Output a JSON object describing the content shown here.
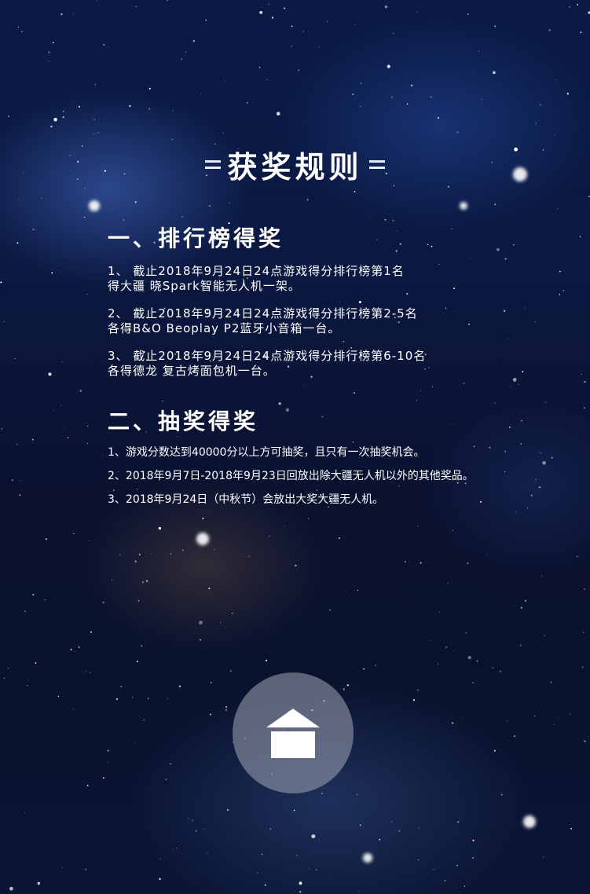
{
  "page": {
    "title": "获奖规则",
    "home_icon": "home-icon"
  },
  "rank_section": {
    "heading": "一、排行榜得奖",
    "rules": [
      {
        "line1": "1、 截止2018年9月24日24点游戏得分排行榜第1名",
        "line2": "得大疆 晓Spark智能无人机一架。"
      },
      {
        "line1": "2、 截止2018年9月24日24点游戏得分排行榜第2-5名",
        "line2": "各得B&O Beoplay P2蓝牙小音箱一台。"
      },
      {
        "line1": "3、 截止2018年9月24日24点游戏得分排行榜第6-10名",
        "line2": "各得德龙 复古烤面包机一台。"
      }
    ]
  },
  "lottery_section": {
    "heading": "二、抽奖得奖",
    "rules": [
      "1、游戏分数达到40000分以上方可抽奖，且只有一次抽奖机会。",
      "2、2018年9月7日-2018年9月23日回放出除大疆无人机以外的其他奖品。",
      "3、2018年9月24日（中秋节）会放出大奖大疆无人机。"
    ]
  }
}
